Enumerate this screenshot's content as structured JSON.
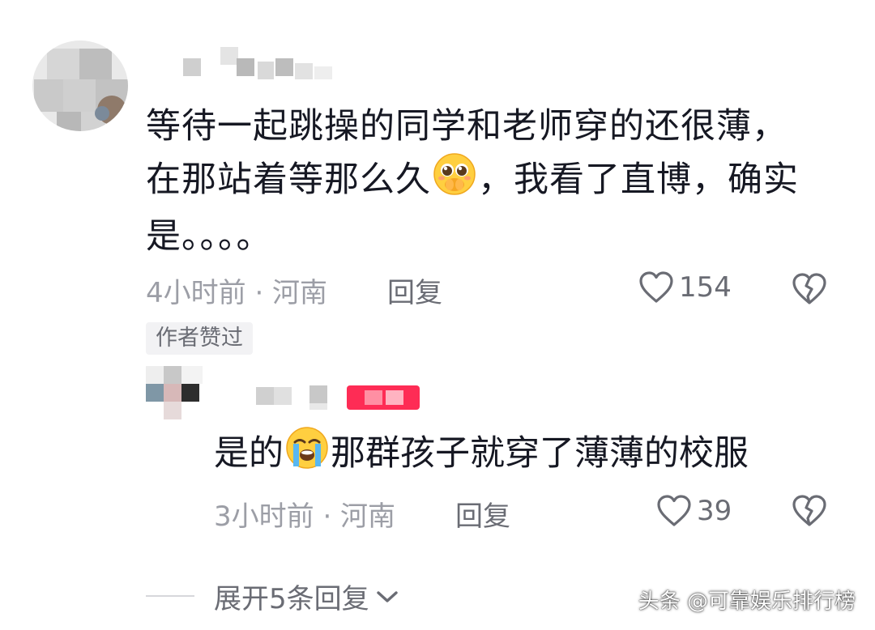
{
  "comment": {
    "lines": [
      "等待一起跳操的同学和老师穿的还很薄，",
      "在那站着等那么久",
      "，我看了直博，确实",
      "是。。。。"
    ],
    "emoji": "pleading-face-hands-over-mouth",
    "meta": "4小时前 · 河南",
    "reply_label": "回复",
    "likes": "154",
    "author_badge": "作者赞过"
  },
  "reply": {
    "text_before": "是的",
    "emoji": "loudly-crying-face",
    "text_after": "那群孩子就穿了薄薄的校服",
    "meta": "3小时前 · 河南",
    "reply_label": "回复",
    "likes": "39"
  },
  "expand": {
    "label": "展开5条回复"
  },
  "watermark": {
    "text": "头条 @可靠娱乐排行榜"
  },
  "colors": {
    "text_primary": "#161823",
    "text_meta": "#9c9ea6",
    "text_action": "#6a6c74",
    "badge_bg": "#f2f2f4",
    "tag_red": "#fe2c55"
  }
}
